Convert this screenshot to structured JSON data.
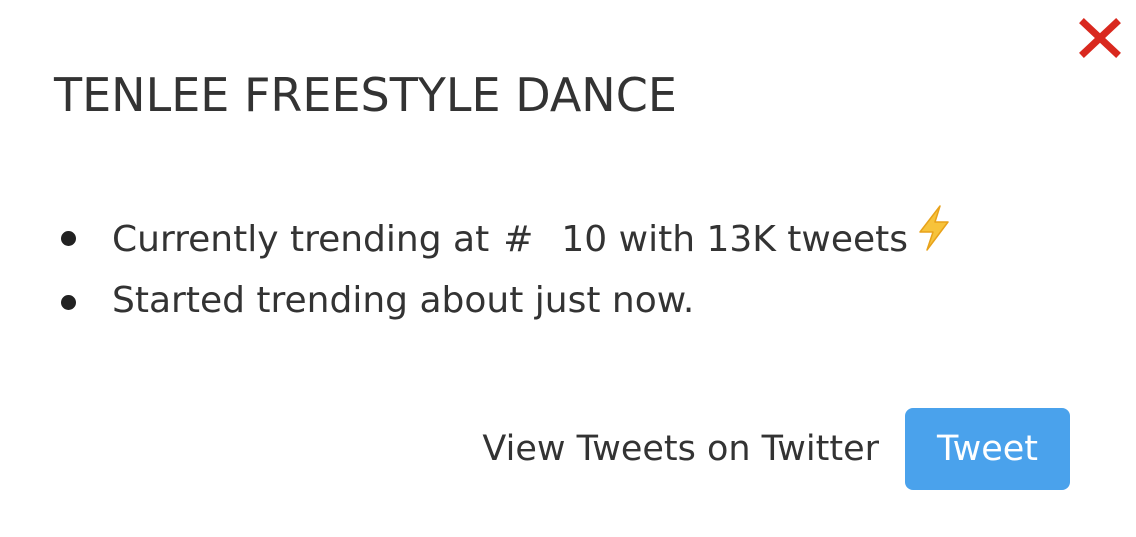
{
  "dialog": {
    "title": "TENLEE FREESTYLE DANCE",
    "close_icon": "close-icon",
    "close_color": "#d9281e"
  },
  "facts": {
    "rank_prefix": "Currently trending at",
    "hash": "#",
    "rank_suffix": "10 with 13K tweets",
    "rank_icon": "lightning-bolt-icon",
    "started": "Started trending about just now."
  },
  "actions": {
    "view_label": "View Tweets on Twitter",
    "tweet_label": "Tweet",
    "tweet_color": "#4aa2ec"
  }
}
